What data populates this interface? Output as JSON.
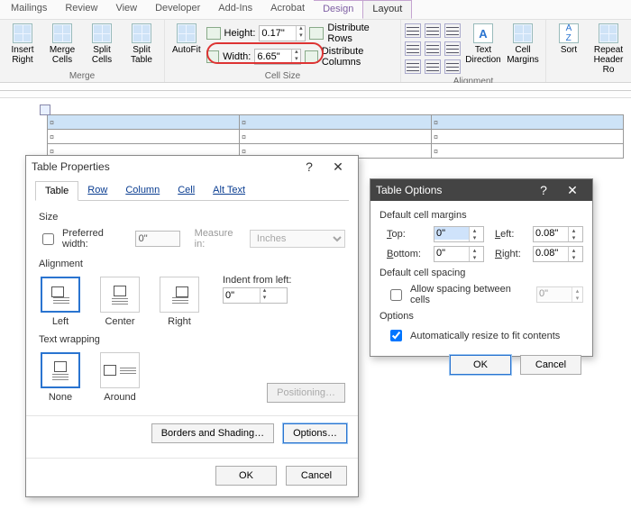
{
  "tabs": [
    "Mailings",
    "Review",
    "View",
    "Developer",
    "Add-Ins",
    "Acrobat",
    "Design",
    "Layout"
  ],
  "active_tab": "Layout",
  "ribbon": {
    "merge": {
      "insert_right": "Insert\nRight",
      "merge_cells": "Merge\nCells",
      "split_cells": "Split\nCells",
      "split_table": "Split\nTable",
      "group": "Merge"
    },
    "cellsize": {
      "autofit": "AutoFit",
      "height_label": "Height:",
      "height_value": "0.17\"",
      "width_label": "Width:",
      "width_value": "6.65\"",
      "dist_rows": "Distribute Rows",
      "dist_cols": "Distribute Columns",
      "group": "Cell Size"
    },
    "alignment": {
      "text_direction": "Text\nDirection",
      "cell_margins": "Cell\nMargins",
      "group": "Alignment"
    },
    "data": {
      "sort": "Sort",
      "repeat_header": "Repeat\nHeader Ro"
    }
  },
  "props_dialog": {
    "title": "Table Properties",
    "tabs": [
      "Table",
      "Row",
      "Column",
      "Cell",
      "Alt Text"
    ],
    "size_label": "Size",
    "preferred_width": "Preferred width:",
    "preferred_value": "0\"",
    "measure_in": "Measure in:",
    "measure_value": "Inches",
    "alignment_label": "Alignment",
    "alignment_opts": [
      "Left",
      "Center",
      "Right"
    ],
    "indent_label": "Indent from left:",
    "indent_value": "0\"",
    "wrap_label": "Text wrapping",
    "wrap_opts": [
      "None",
      "Around"
    ],
    "positioning": "Positioning…",
    "borders": "Borders and Shading…",
    "options": "Options…",
    "ok": "OK",
    "cancel": "Cancel"
  },
  "opts_dialog": {
    "title": "Table Options",
    "margins_label": "Default cell margins",
    "top": "Top:",
    "bottom": "Bottom:",
    "left": "Left:",
    "right": "Right:",
    "top_v": "0\"",
    "bottom_v": "0\"",
    "left_v": "0.08\"",
    "right_v": "0.08\"",
    "spacing_label": "Default cell spacing",
    "allow_spacing": "Allow spacing between cells",
    "spacing_v": "0\"",
    "options_label": "Options",
    "auto_resize": "Automatically resize to fit contents",
    "ok": "OK",
    "cancel": "Cancel"
  }
}
